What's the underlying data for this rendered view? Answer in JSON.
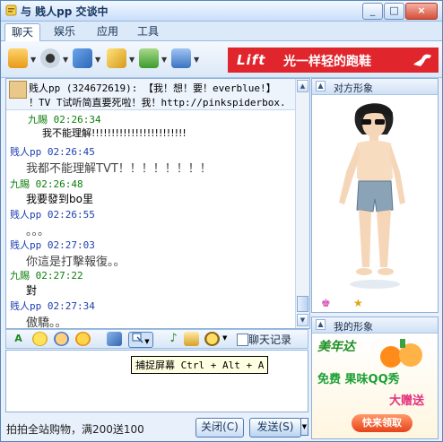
{
  "window": {
    "title": "与 贱人pp 交谈中",
    "buttons": [
      "_",
      "□",
      "×"
    ]
  },
  "tabs": [
    {
      "label": "聊天",
      "active": true
    },
    {
      "label": "娱乐",
      "active": false
    },
    {
      "label": "应用",
      "active": false
    },
    {
      "label": "工具",
      "active": false
    }
  ],
  "toolbar_icons": [
    "video-chat-icon",
    "webcam-icon",
    "send-file-icon",
    "draw-icon",
    "add-friend-icon",
    "voice-icon"
  ],
  "ad_banner": {
    "brand": "Lift",
    "slogan": "光一样轻的跑鞋",
    "logo": "PUMA",
    "bg_color": "#e0252d"
  },
  "bulletin": {
    "line1": "贱人pp (324672619): 【我！想！要！everblue!】",
    "line2": "！TV T试听简直要死啦！我！http://pinkspiderbox."
  },
  "messages": [
    {
      "sender": "九賜",
      "time": "02:26:34",
      "text": "我不能理解!!!!!!!!!!!!!!!!!!!!!!!!",
      "kind": "jiu"
    },
    {
      "sender": "贱人pp",
      "time": "02:26:45",
      "text": "我都不能理解TVT！！！！！！！！",
      "kind": "jian"
    },
    {
      "sender": "九賜",
      "time": "02:26:48",
      "text": "我要發到bo里",
      "kind": "jiu"
    },
    {
      "sender": "贱人pp",
      "time": "02:26:55",
      "text": "。。。",
      "kind": "jian"
    },
    {
      "sender": "贱人pp",
      "time": "02:27:03",
      "text": "你這是打擊報復。。",
      "kind": "jian"
    },
    {
      "sender": "九賜",
      "time": "02:27:22",
      "text": "對",
      "kind": "jiu"
    },
    {
      "sender": "贱人pp",
      "time": "02:27:34",
      "text": "傲驕。。",
      "kind": "jian"
    }
  ],
  "input_toolbar": {
    "icons": [
      "font-icon",
      "emoticon-icon",
      "magic-emoticon-icon",
      "nudge-icon",
      "send-image-icon",
      "screenshot-icon",
      "music-icon",
      "game-icon",
      "gift-icon"
    ],
    "history_label": "聊天记录"
  },
  "tooltip": "捕捉屏幕 Ctrl + Alt + A",
  "status": "拍拍全站购物，满200送100",
  "buttons": {
    "close": "关闭(C)",
    "send": "发送(S)"
  },
  "right": {
    "peer_title": "对方形象",
    "mine_title": "我的形象",
    "ad2": {
      "brand": "美年达",
      "line1": "免费 果味QQ秀",
      "line2": "大赠送",
      "cta": "快来领取"
    }
  }
}
